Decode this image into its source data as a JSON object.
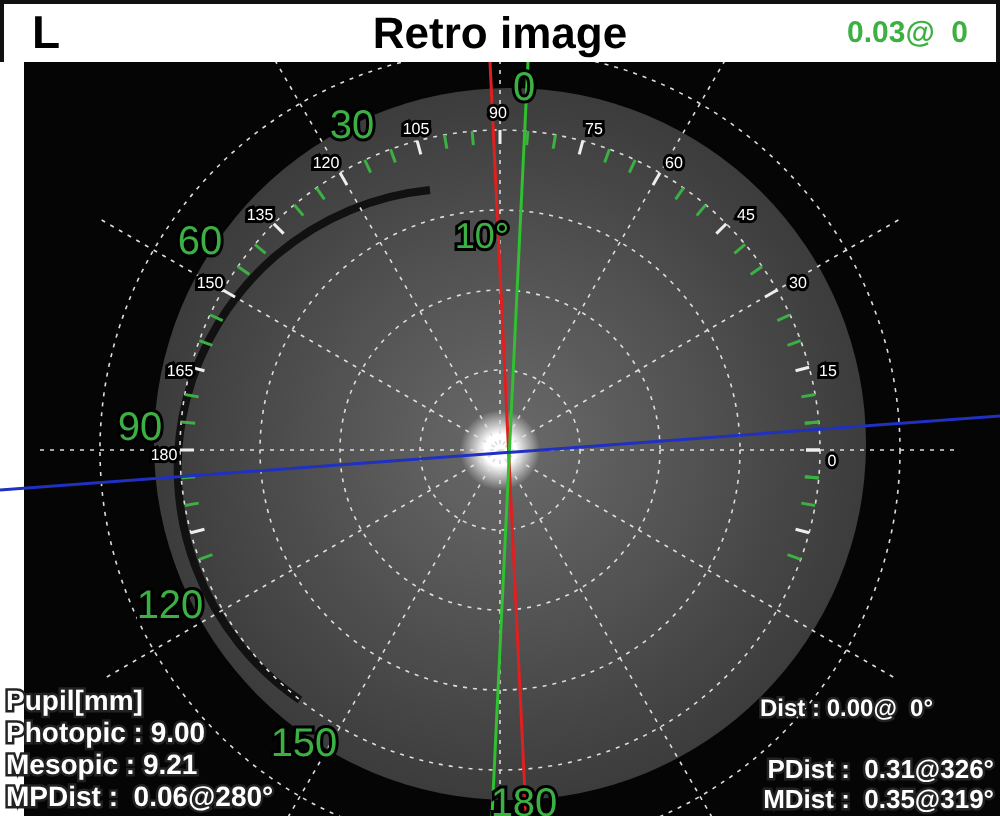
{
  "header": {
    "eye": "L",
    "title": "Retro image",
    "reading": "0.03@  0"
  },
  "view": {
    "angle_labels": [
      "0",
      "30",
      "60",
      "90",
      "120",
      "150",
      "180"
    ],
    "scale_labels": [
      "90",
      "105",
      "75",
      "120",
      "60",
      "135",
      "45",
      "150",
      "30",
      "165",
      "15",
      "180",
      "0"
    ],
    "ring_label": "10°",
    "pupil": {
      "heading": "Pupil[mm]",
      "lines": [
        "Photopic : 9.00",
        "Mesopic : 9.21",
        "MPDist :  0.06@280°"
      ]
    },
    "dist": "Dist : 0.00@  0°",
    "distances": [
      "PDist :  0.31@326°",
      "MDist :  0.35@319°"
    ]
  }
}
